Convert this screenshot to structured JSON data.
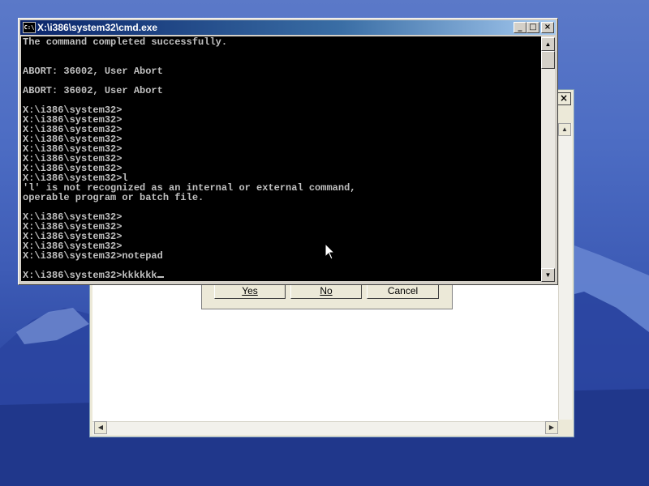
{
  "desktop": {
    "background": "#3e5cb6"
  },
  "notepad": {
    "close_icon": "×",
    "scroll_up": "▲",
    "scroll_left": "◀",
    "scroll_right": "▶"
  },
  "dialog": {
    "yes_label": "Yes",
    "no_label": "No",
    "cancel_label": "Cancel"
  },
  "cmd": {
    "title": "X:\\i386\\system32\\cmd.exe",
    "icon_text": "C:\\",
    "minimize": "_",
    "maximize": "□",
    "close": "×",
    "scroll_up": "▲",
    "scroll_down": "▼",
    "lines": [
      "The command completed successfully.",
      "",
      "",
      "ABORT: 36002, User Abort",
      "",
      "ABORT: 36002, User Abort",
      "",
      "X:\\i386\\system32>",
      "X:\\i386\\system32>",
      "X:\\i386\\system32>",
      "X:\\i386\\system32>",
      "X:\\i386\\system32>",
      "X:\\i386\\system32>",
      "X:\\i386\\system32>",
      "X:\\i386\\system32>l",
      "'l' is not recognized as an internal or external command,",
      "operable program or batch file.",
      "",
      "X:\\i386\\system32>",
      "X:\\i386\\system32>",
      "X:\\i386\\system32>",
      "X:\\i386\\system32>",
      "X:\\i386\\system32>notepad",
      "",
      "X:\\i386\\system32>kkkkkk"
    ]
  }
}
